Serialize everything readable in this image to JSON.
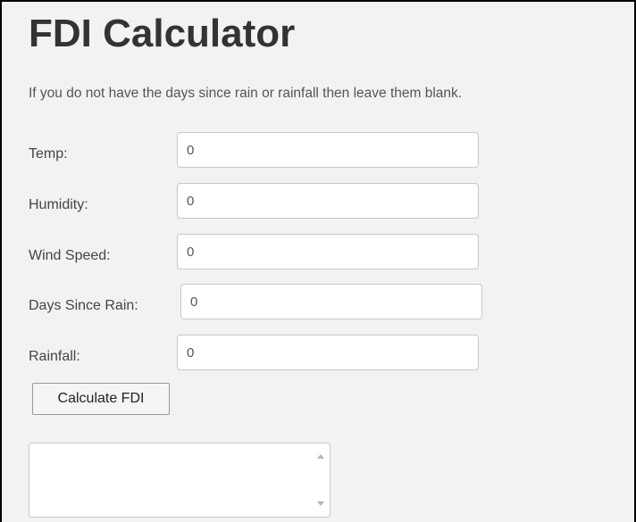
{
  "page": {
    "title": "FDI Calculator",
    "instructions": "If you do not have the days since rain or rainfall then leave them blank."
  },
  "form": {
    "fields": [
      {
        "label": "Temp:",
        "value": "0"
      },
      {
        "label": "Humidity:",
        "value": "0"
      },
      {
        "label": "Wind Speed:",
        "value": "0"
      },
      {
        "label": "Days Since Rain:",
        "value": "0"
      },
      {
        "label": "Rainfall:",
        "value": "0"
      }
    ],
    "submit_label": "Calculate FDI"
  },
  "result": {
    "value": ""
  },
  "icons": {
    "scroll_up": "chevron-up-icon",
    "scroll_down": "chevron-down-icon"
  }
}
